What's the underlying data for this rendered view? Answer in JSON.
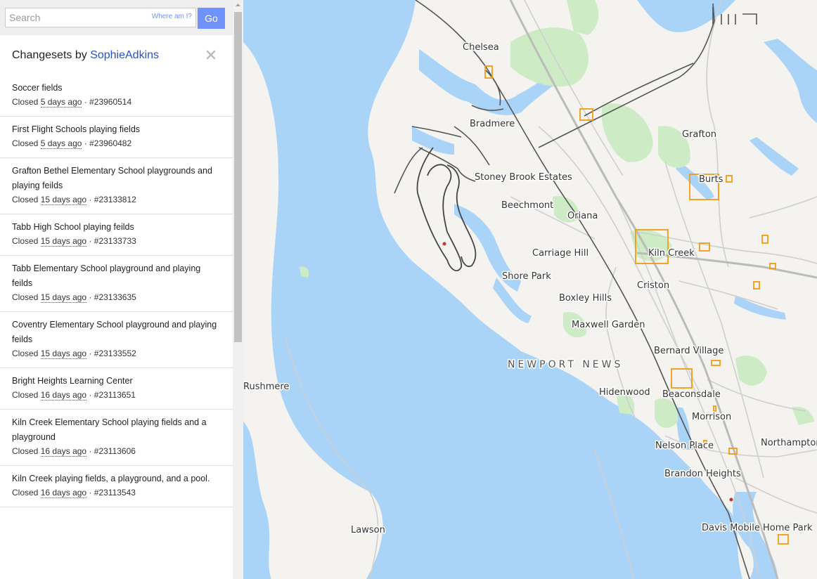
{
  "search": {
    "placeholder": "Search",
    "where_am_i": "Where am I?",
    "go_label": "Go"
  },
  "panel": {
    "title_prefix": "Changesets by",
    "user": "SophieAdkins",
    "close_symbol": "✕"
  },
  "changesets": [
    {
      "title": "Soccer fields",
      "status": "Closed",
      "ago": "5 days ago",
      "id": "#23960514"
    },
    {
      "title": "First Flight Schools playing fields",
      "status": "Closed",
      "ago": "5 days ago",
      "id": "#23960482"
    },
    {
      "title": "Grafton Bethel Elementary School playgrounds and playing feilds",
      "status": "Closed",
      "ago": "15 days ago",
      "id": "#23133812"
    },
    {
      "title": "Tabb High School playing feilds",
      "status": "Closed",
      "ago": "15 days ago",
      "id": "#23133733"
    },
    {
      "title": "Tabb Elementary School playground and playing feilds",
      "status": "Closed",
      "ago": "15 days ago",
      "id": "#23133635"
    },
    {
      "title": "Coventry Elementary School playground and playing feilds",
      "status": "Closed",
      "ago": "15 days ago",
      "id": "#23133552"
    },
    {
      "title": "Bright Heights Learning Center",
      "status": "Closed",
      "ago": "16 days ago",
      "id": "#23113651"
    },
    {
      "title": "Kiln Creek Elementary School playing fields and a playground",
      "status": "Closed",
      "ago": "16 days ago",
      "id": "#23113606"
    },
    {
      "title": "Kiln Creek playing fields, a playground, and a pool.",
      "status": "Closed",
      "ago": "16 days ago",
      "id": "#23113543"
    }
  ],
  "map": {
    "city_label": "NEWPORT NEWS",
    "places": [
      "Chelsea",
      "Bradmere",
      "Grafton",
      "Burts",
      "Stoney Brook Estates",
      "Beechmont",
      "Oriana",
      "Carriage Hill",
      "Kiln Creek",
      "Shore Park",
      "Criston",
      "Boxley Hills",
      "Maxwell Garden",
      "Bernard Village",
      "Hidenwood",
      "Beaconsdale",
      "Rushmere",
      "Morrison",
      "Nelson Place",
      "Northampton",
      "Brandon Heights",
      "Lawson",
      "Davis Mobile Home Park"
    ],
    "colors": {
      "water": "#aad3f8",
      "land": "#f4f3ef",
      "park": "#cdebc5",
      "highlight": "#f39c12"
    }
  }
}
